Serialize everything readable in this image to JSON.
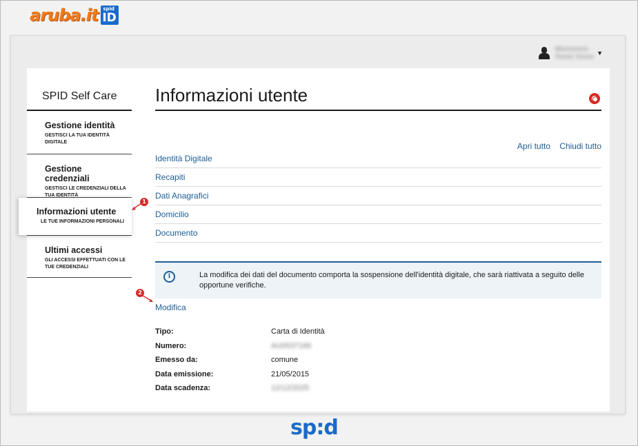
{
  "header": {
    "logo_text": "aruba.it",
    "logo_badge_small": "spid",
    "logo_badge_big": "ID"
  },
  "user": {
    "name_line1": "Mxxxxxxxx",
    "name_line2": "Xxxxx Xxxxx"
  },
  "sidebar": {
    "title": "SPID Self Care",
    "items": [
      {
        "title": "Gestione identità",
        "subtitle": "GESTISCI LA TUA IDENTITÀ DIGITALE"
      },
      {
        "title": "Gestione credenziali",
        "subtitle": "GESTISCI LE CREDENZIALI DELLA TUA IDENTITÀ"
      },
      {
        "title": "Informazioni utente",
        "subtitle": "LE TUE INFORMAZIONI PERSONALI"
      },
      {
        "title": "Ultimi accessi",
        "subtitle": "GLI ACCESSI EFFETTUATI CON LE TUE CREDENZIALI"
      }
    ]
  },
  "main": {
    "title": "Informazioni utente",
    "open_all": "Apri tutto",
    "close_all": "Chiudi tutto",
    "sections": [
      "Identità Digitale",
      "Recapiti",
      "Dati Anagrafici",
      "Domicilio",
      "Documento"
    ],
    "notice": "La modifica dei dati del documento comporta la sospensione dell'identità digitale, che sarà riattivata a seguito delle opportune verifiche.",
    "info_glyph": "i",
    "edit_link": "Modifica",
    "details": [
      {
        "label": "Tipo:",
        "value": "Carta di Identità",
        "hidden": false
      },
      {
        "label": "Numero:",
        "value": "AU0537166",
        "hidden": true
      },
      {
        "label": "Emesso da:",
        "value": "comune",
        "hidden": false
      },
      {
        "label": "Data emissione:",
        "value": "21/05/2015",
        "hidden": false
      },
      {
        "label": "Data scadenza:",
        "value": "12/12/2025",
        "hidden": true
      }
    ]
  },
  "annotations": [
    "1",
    "2"
  ],
  "footer": {
    "logo": "sp:d"
  },
  "colors": {
    "link": "#1b5d96",
    "brand_orange": "#f07c1a",
    "spid_blue": "#1b6ac9",
    "annotation_red": "#d62b2b"
  }
}
